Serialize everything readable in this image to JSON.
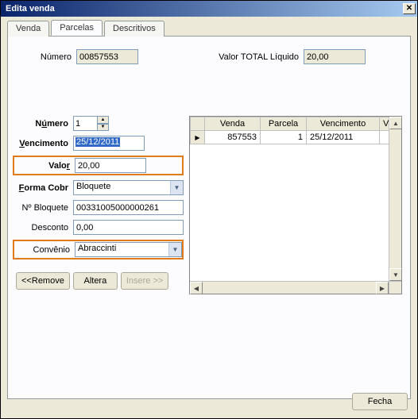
{
  "window": {
    "title": "Edita venda"
  },
  "tabs": {
    "venda": "Venda",
    "parcelas": "Parcelas",
    "descritivos": "Descritivos"
  },
  "top": {
    "numero_label": "Número",
    "numero_value": "00857553",
    "total_label": "Valor TOTAL Líquido",
    "total_value": "20,00"
  },
  "fields": {
    "numero": {
      "label_pre": "N",
      "label_u": "ú",
      "label_post": "mero",
      "value": "1"
    },
    "vencimento": {
      "label_u": "V",
      "label_post": "encimento",
      "value": "25/12/2011"
    },
    "valor": {
      "label_pre": "Valo",
      "label_u": "r",
      "value": "20,00"
    },
    "forma": {
      "label_u": "F",
      "label_post": "orma Cobr",
      "value": "Bloquete"
    },
    "bloquete": {
      "label": "Nº Bloquete",
      "value": "00331005000000261"
    },
    "desconto": {
      "label": "Desconto",
      "value": "0,00"
    },
    "convenio": {
      "label": "Convênio",
      "value": "Abraccinti"
    }
  },
  "buttons": {
    "remove_pre": "<< ",
    "remove_u": "R",
    "remove_post": "emove",
    "altera_u": "A",
    "altera_post": "ltera",
    "insere_u": "I",
    "insere_post": "nsere >>",
    "fecha_u": "F",
    "fecha_post": "echa"
  },
  "grid": {
    "headers": {
      "venda": "Venda",
      "parcela": "Parcela",
      "vencimento": "Vencimento",
      "valor": "Valo"
    },
    "rows": [
      {
        "venda": "857553",
        "parcela": "1",
        "vencimento": "25/12/2011"
      }
    ]
  }
}
